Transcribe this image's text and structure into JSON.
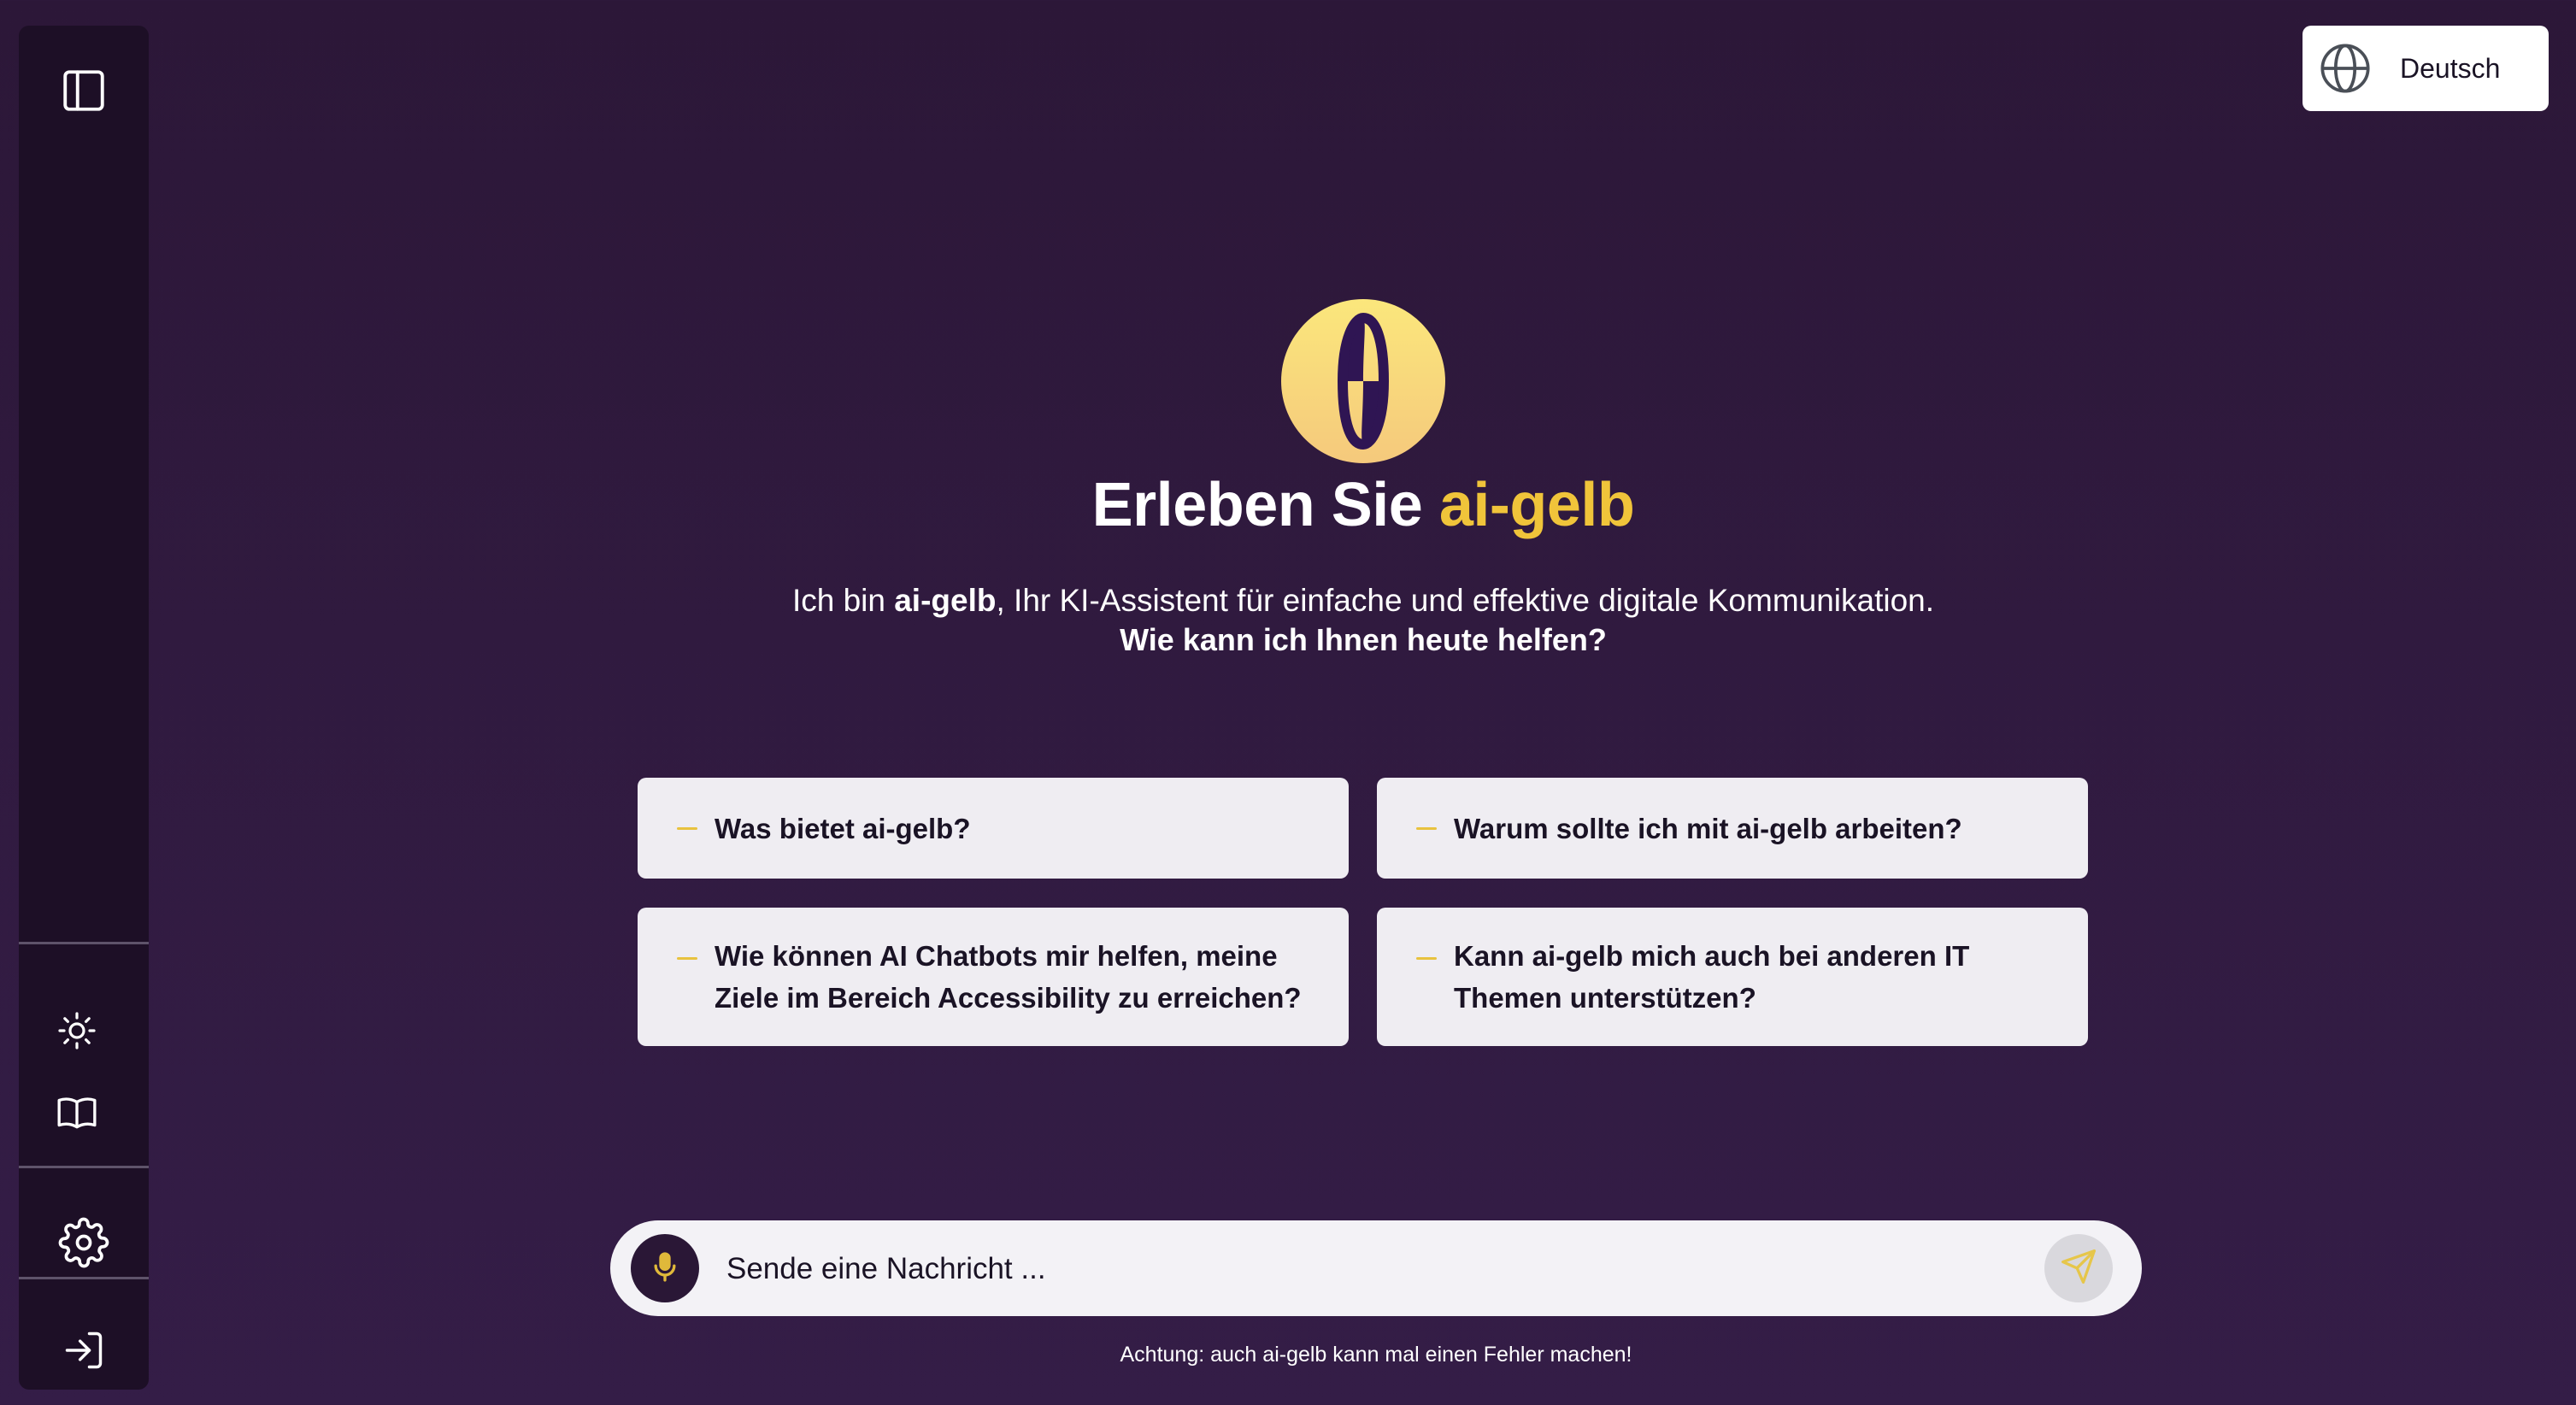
{
  "sidebar": {
    "toggle_icon": "sidebar-toggle-icon",
    "theme_icon": "sun-icon",
    "docs_icon": "book-icon",
    "settings_icon": "gear-icon",
    "login_icon": "login-icon"
  },
  "language": {
    "label": "Deutsch",
    "icon": "globe-icon"
  },
  "hero": {
    "logo_icon": "ai-gelb-logo",
    "title_prefix": "Erleben Sie",
    "title_accent": "ai-gelb",
    "intro_prefix": "Ich bin",
    "intro_brand": "ai-gelb",
    "intro_suffix": ", Ihr KI-Assistent für einfache und effektive digitale Kommunikation.",
    "question": "Wie kann ich Ihnen heute helfen?"
  },
  "suggestions": [
    {
      "text": "Was bietet ai-gelb?"
    },
    {
      "text": "Warum sollte ich mit ai-gelb arbeiten?"
    },
    {
      "line1": "Wie können AI Chatbots mir helfen, meine",
      "line2": "Ziele im Bereich Accessibility zu erreichen?"
    },
    {
      "line1": "Kann ai-gelb mich auch bei anderen IT",
      "line2": "Themen unterstützen?"
    }
  ],
  "composer": {
    "placeholder": "Sende eine Nachricht ...",
    "mic_icon": "microphone-icon",
    "send_icon": "send-icon"
  },
  "disclaimer": "Achtung: auch ai-gelb kann mal einen Fehler machen!",
  "colors": {
    "background": "#2e1a3d",
    "sidebar": "#1d0f26",
    "accent": "#f0c43a",
    "card": "#efedf2"
  }
}
